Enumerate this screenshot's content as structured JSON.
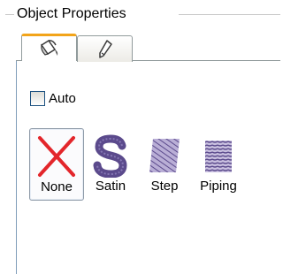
{
  "panel": {
    "title": "Object Properties"
  },
  "tabs": [
    {
      "icon": "paint-bucket-icon",
      "active": true
    },
    {
      "icon": "pen-icon",
      "active": false
    }
  ],
  "auto": {
    "label": "Auto",
    "checked": false
  },
  "stitch_types": [
    {
      "label": "None",
      "icon": "red-x-icon",
      "selected": true
    },
    {
      "label": "Satin",
      "icon": "satin-s-icon",
      "selected": false
    },
    {
      "label": "Step",
      "icon": "step-fill-icon",
      "selected": false
    },
    {
      "label": "Piping",
      "icon": "piping-icon",
      "selected": false
    }
  ],
  "colors": {
    "accent_tab": "#f2a41a",
    "none_x": "#e3262b",
    "stitch_purple": "#5b4a8c"
  }
}
